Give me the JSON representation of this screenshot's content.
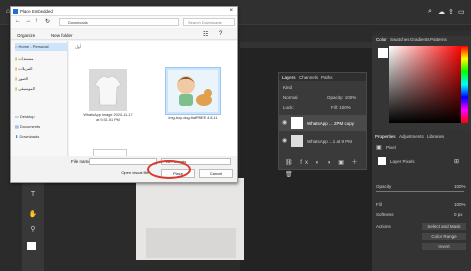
{
  "dialog": {
    "title": "Place Embedded",
    "breadcrumb": "Downloads",
    "search_placeholder": "Search Downloads",
    "organize": "Organize",
    "new_folder": "New folder",
    "nav_items": [
      "Home - Personal",
      "مستندات",
      "التنزيلات",
      "الصور",
      "الموسيقى",
      "Desktop",
      "Documents",
      "Downloads"
    ],
    "group_label": "أول",
    "files": [
      {
        "caption": "WhatsApp Image 2024-11-17 at 9.51.51 PM"
      },
      {
        "caption": "img-boy-dog-flatPBEE 4.8.11"
      }
    ],
    "filename_label": "File name:",
    "filetype": "All Formats",
    "open_label": "Open visual file",
    "place_button": "Place",
    "cancel_button": "Cancel"
  },
  "layers": {
    "tabs": [
      "Layers",
      "Channels",
      "Paths"
    ],
    "kind": "Kind",
    "blend": "Normal",
    "opacity": "Opacity: 100%",
    "fill": "Fill: 100%",
    "lock": "Lock:",
    "items": [
      "WhatsApp ... 2PM copy",
      "WhatsApp ...1 at 9 PM"
    ]
  },
  "panels": {
    "color_tabs": [
      "Color",
      "Swatches",
      "Gradients",
      "Patterns"
    ],
    "props_tabs": [
      "Properties",
      "Adjustments",
      "Libraries"
    ],
    "props_header": "Pixel",
    "props_layer": "Layer Pixels",
    "labels": [
      "Opacity",
      "Fill",
      "Softness"
    ],
    "values": [
      "100%",
      "100%",
      "0 px"
    ],
    "actions_title": "Actions",
    "actions": [
      "Select and Mask",
      "Color Range",
      "Invert"
    ]
  },
  "colors": {
    "dark_bg": "#2b2b2b",
    "panel": "#333333",
    "dialog": "#f2f2f2",
    "highlight": "#d93a2f",
    "accent": "#1e6fd9"
  }
}
